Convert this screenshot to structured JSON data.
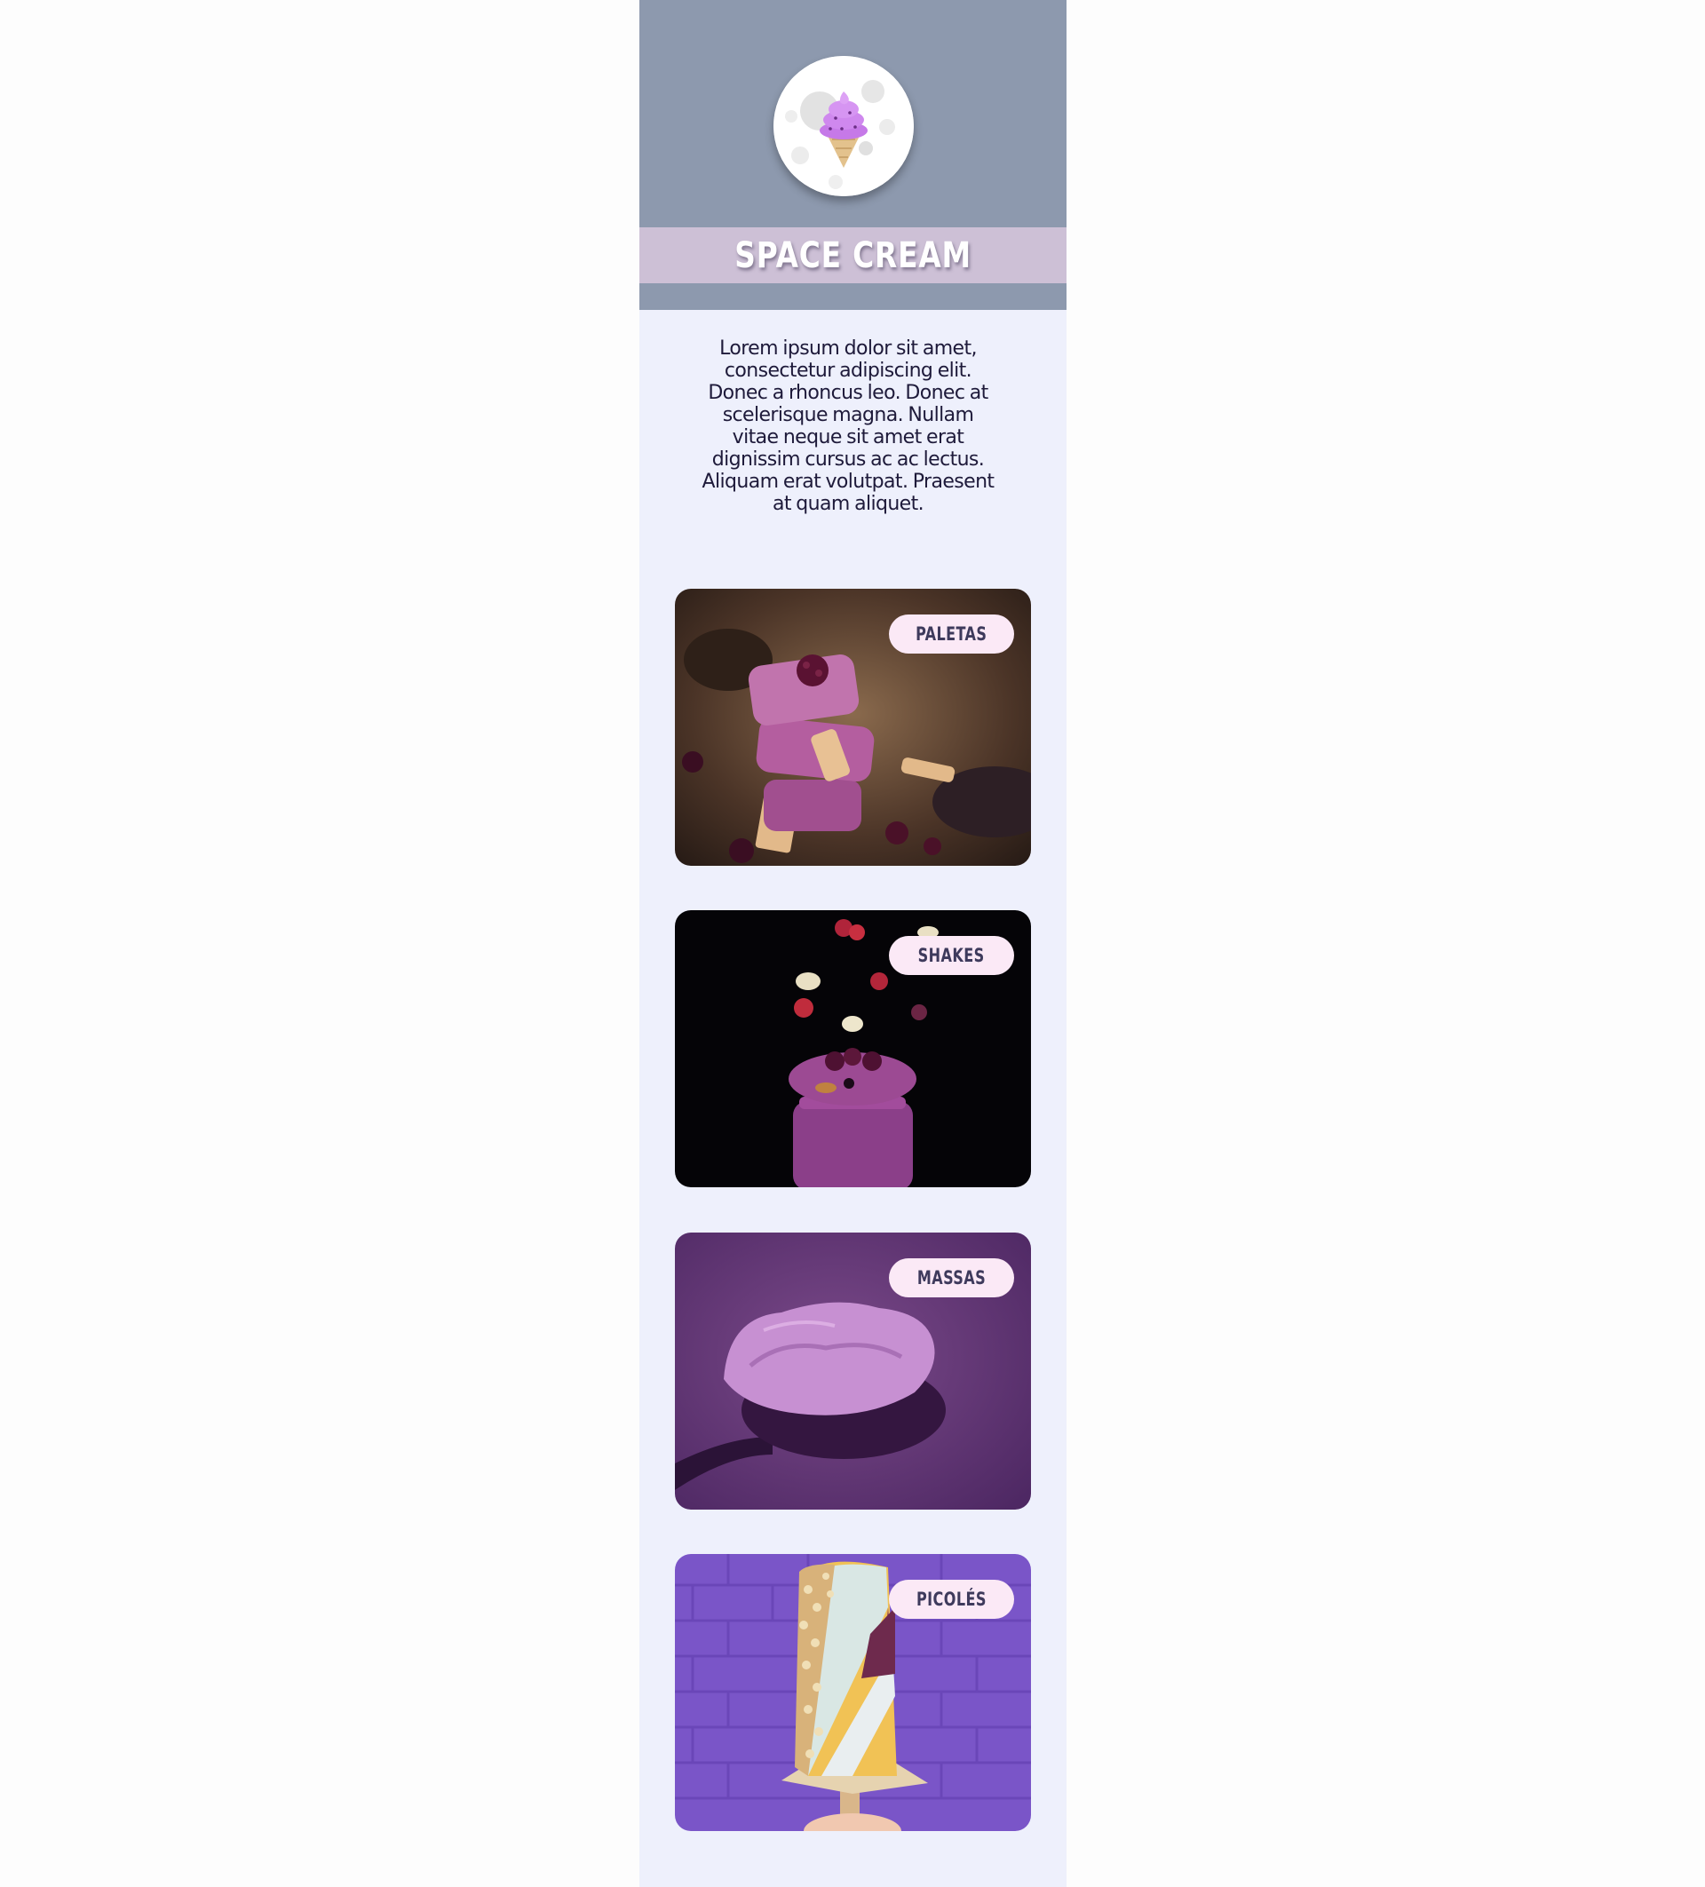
{
  "brand": {
    "title": "SPACE CREAM",
    "logo_icon": "ice-cream-cone-icon"
  },
  "intro": {
    "text": "Lorem ipsum dolor sit amet, consectetur adipiscing elit. Donec a rhoncus leo. Donec at scelerisque magna. Nullam vitae neque sit amet erat dignissim cursus ac ac lectus. Aliquam erat volutpat. Praesent at quam aliquet."
  },
  "categories": [
    {
      "label": "PALETAS"
    },
    {
      "label": "SHAKES"
    },
    {
      "label": "MASSAS"
    },
    {
      "label": "PICOLÉS"
    }
  ],
  "colors": {
    "header_bg": "#8d99ae",
    "title_band": "#cdc0d6",
    "page_bg": "#eef0fc",
    "badge_bg": "#fbe9f6",
    "badge_text": "#3e3a5c",
    "accent_purple": "#c679e8"
  }
}
